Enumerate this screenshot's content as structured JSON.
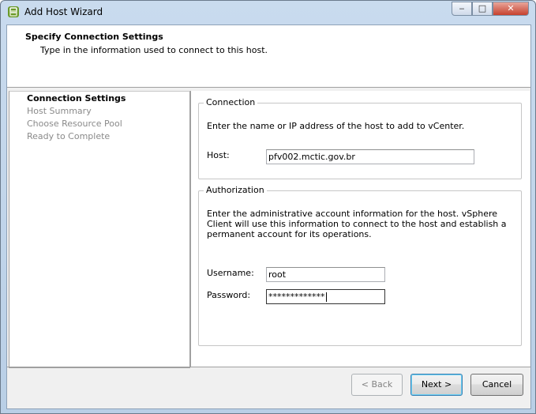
{
  "window": {
    "title": "Add Host Wizard",
    "controls": {
      "minimize": "‒",
      "maximize": "□",
      "close": "✕"
    }
  },
  "header": {
    "title": "Specify Connection Settings",
    "subtitle": "Type in the information used to connect to this host."
  },
  "steps": [
    {
      "label": "Connection Settings",
      "active": true
    },
    {
      "label": "Host Summary",
      "active": false
    },
    {
      "label": "Choose Resource Pool",
      "active": false
    },
    {
      "label": "Ready to Complete",
      "active": false
    }
  ],
  "connection": {
    "legend": "Connection",
    "description": "Enter the name or IP address of the host to add to vCenter.",
    "host_label": "Host:",
    "host_value": "pfv002.mctic.gov.br"
  },
  "authorization": {
    "legend": "Authorization",
    "description": "Enter the administrative account information for the host. vSphere Client will use this information to connect to the host and establish a permanent account for its operations.",
    "username_label": "Username:",
    "username_value": "root",
    "password_label": "Password:",
    "password_value": "*************"
  },
  "buttons": {
    "back": "< Back",
    "next": "Next >",
    "cancel": "Cancel"
  },
  "colors": {
    "titlebar": "#c9dbee",
    "close_button": "#c7412e"
  }
}
